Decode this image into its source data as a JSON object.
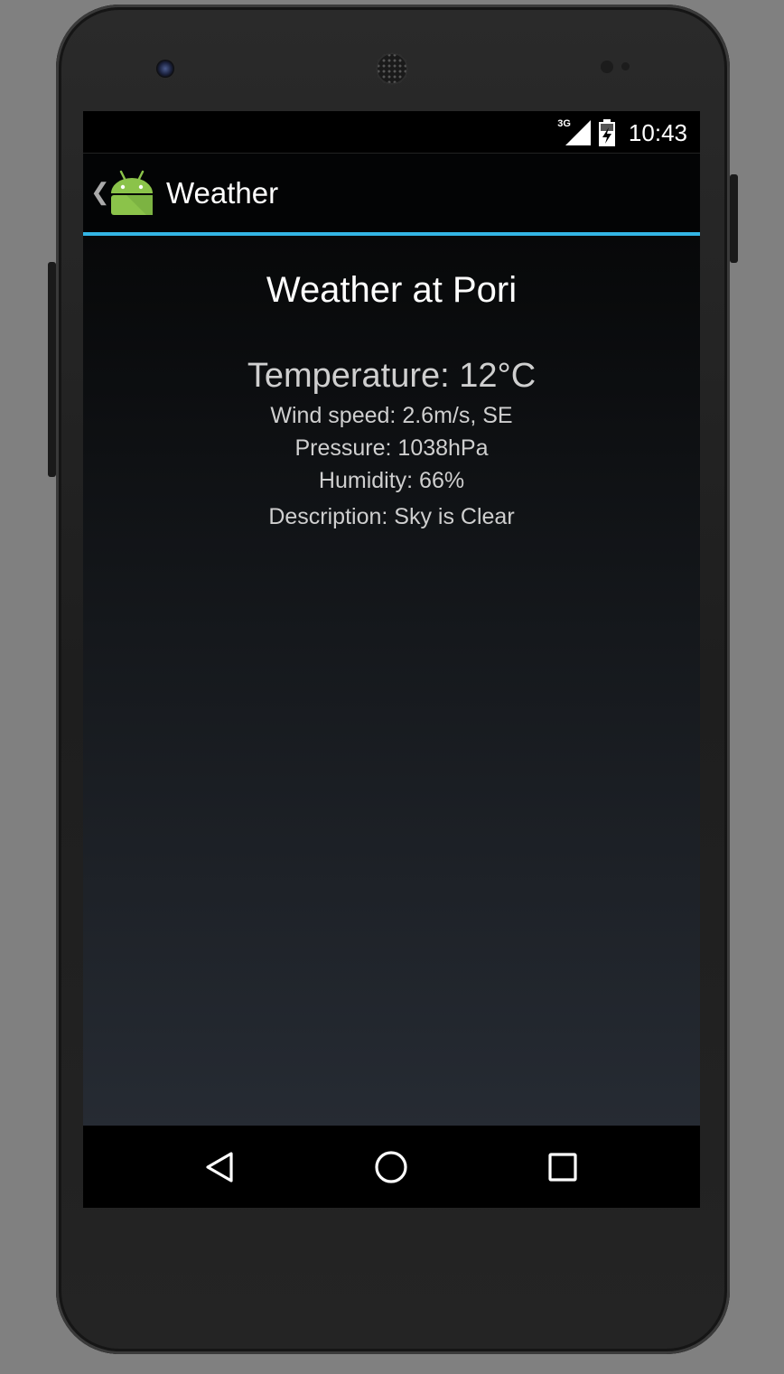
{
  "status_bar": {
    "network": "3G",
    "time": "10:43"
  },
  "action_bar": {
    "title": "Weather",
    "up_icon": "chevron-left-icon",
    "app_icon": "android-robot-icon"
  },
  "weather": {
    "heading": "Weather at Pori",
    "temperature": "Temperature: 12°C",
    "wind": "Wind speed: 2.6m/s, SE",
    "pressure": "Pressure: 1038hPa",
    "humidity": "Humidity: 66%",
    "description": "Description: Sky is Clear"
  },
  "navigation_bar": {
    "back_icon": "back-triangle-icon",
    "home_icon": "home-circle-icon",
    "recents_icon": "recents-square-icon"
  },
  "colors": {
    "accent": "#33b5e5",
    "android_green": "#8bc34a"
  }
}
